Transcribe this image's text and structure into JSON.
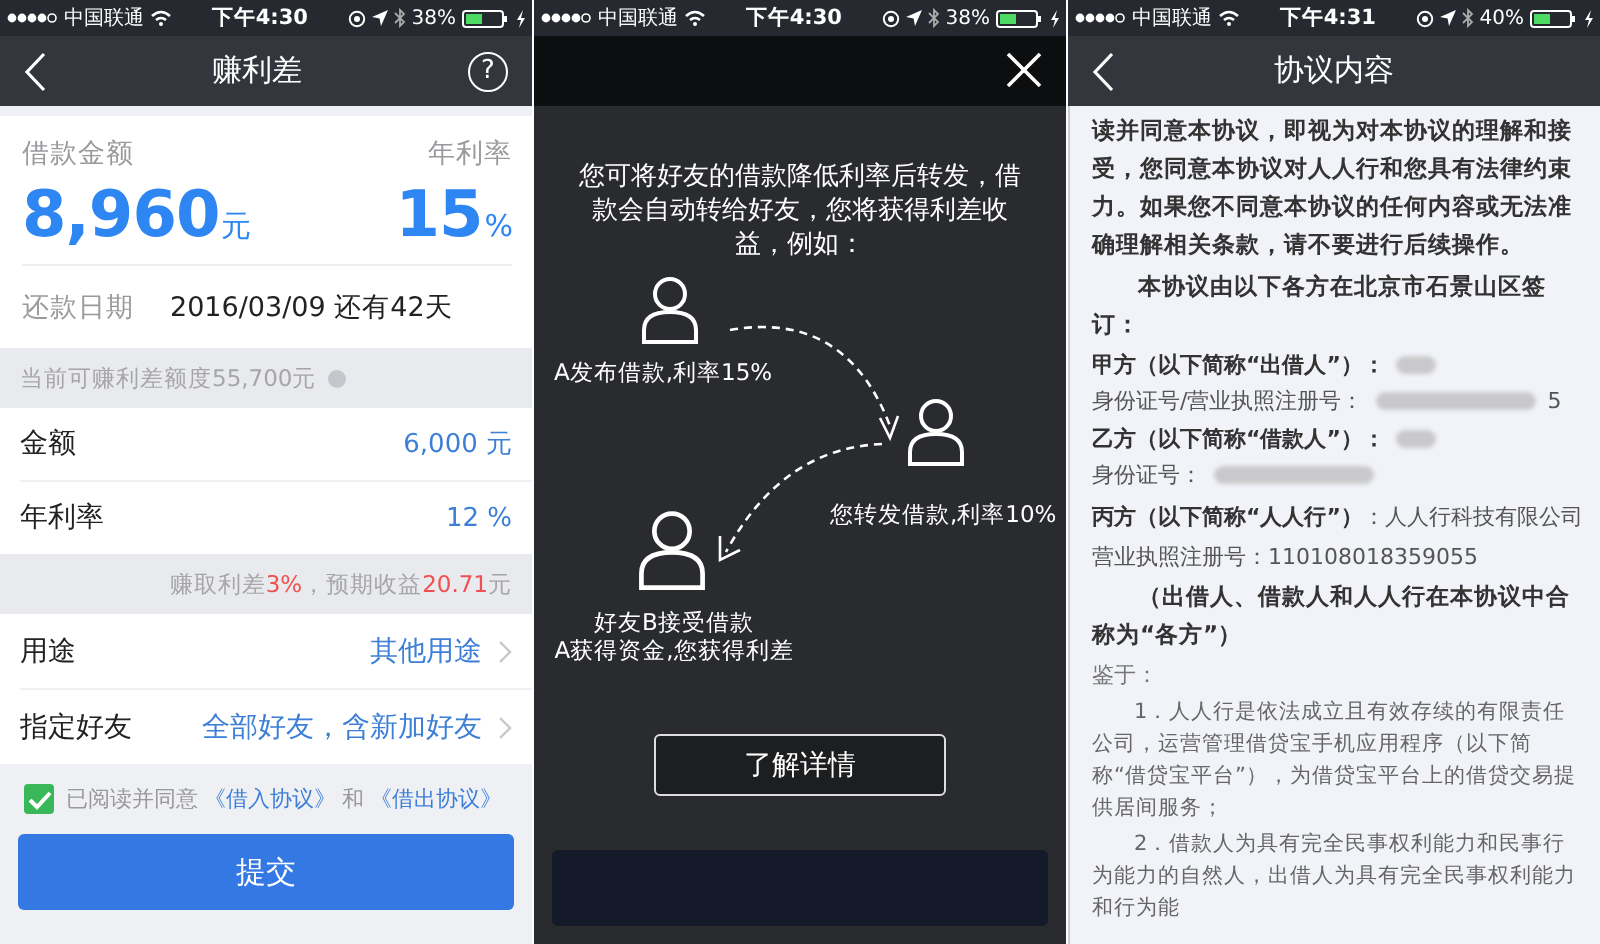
{
  "loan_screen": {
    "status_bar": {
      "carrier": "中国联通",
      "time": "下午4:30",
      "battery": "38%"
    },
    "nav": {
      "title": "赚利差",
      "help": "?"
    },
    "loan": {
      "amount_label": "借款金额",
      "amount": "8,960",
      "amount_unit": "元",
      "rate_label": "年利率",
      "rate": "15",
      "rate_unit": "%",
      "due_label": "还款日期",
      "due_value": "2016/03/09 还有42天",
      "quota_note": "当前可赚利差额度55,700元",
      "rate_rows": [
        {
          "label": "金额",
          "value": "6,000 元"
        },
        {
          "label": "年利率",
          "value": "12 %"
        }
      ],
      "profit_note": "赚取利差**3%**，预期收益**20.71**元",
      "option_rows": [
        {
          "label": "用途",
          "value": "其他用途"
        },
        {
          "label": "指定好友",
          "value": "全部好友，含新加好友"
        }
      ],
      "agreement": {
        "checked": true,
        "text": "已阅读并同意",
        "link_1": "《借入协议》",
        "joiner": "和",
        "link_2": "《借出协议》"
      },
      "submit": "提交"
    }
  },
  "guide_screen": {
    "status_bar": {
      "carrier": "中国联通",
      "time": "下午4:30",
      "battery": "38%"
    },
    "overlay": {
      "intro": "您可将好友的借款降低利率后转发，借款会自动转给好友，您将获得利差收益，例如：",
      "steps": [
        {
          "lines": [
            "A发布借款,利率15%"
          ]
        },
        {
          "lines": [
            "您转发借款,利率10%"
          ]
        },
        {
          "lines": [
            "好友B接受借款",
            "A获得资金,您获得利差"
          ]
        }
      ],
      "button": "了解详情"
    }
  },
  "agreement_screen": {
    "status_bar": {
      "carrier": "中国联通",
      "time": "下午4:31",
      "battery": "40%"
    },
    "nav": {
      "title": "协议内容"
    },
    "paragraphs": [
      {
        "kind": "notice",
        "text": "读并同意本协议，即视为对本协议的理解和接受，您同意本协议对人人行和您具有法律约束力。如果您不同意本协议的任何内容或无法准确理解相关条款，请不要进行后续操作。"
      },
      {
        "kind": "heading",
        "text": "本协议由以下各方在北京市石景山区签订："
      },
      {
        "kind": "party",
        "lines": [
          {
            "kind": "name_redacted",
            "label": "甲方（以下简称“出借人”）："
          },
          {
            "kind": "id_redacted",
            "label": "身份证号/营业执照注册号：",
            "suffix": "5"
          }
        ]
      },
      {
        "kind": "party",
        "lines": [
          {
            "kind": "name_redacted",
            "label": "乙方（以下简称“借款人”）："
          },
          {
            "kind": "id_redacted",
            "label": "身份证号："
          }
        ]
      },
      {
        "kind": "party",
        "lines": [
          {
            "kind": "plain",
            "label": "**丙方（以下简称“人人行”）**：人人行科技有限公司"
          },
          {
            "kind": "plain",
            "label": "营业执照注册号：110108018359055"
          }
        ]
      },
      {
        "kind": "heading",
        "text": "（出借人、借款人和人人行在本协议中合称为“各方”）"
      },
      {
        "kind": "muted",
        "text": "鉴于："
      },
      {
        "kind": "clause",
        "text": "1．人人行是依法成立且有效存续的有限责任公司，运营管理借贷宝手机应用程序（以下简称“借贷宝平台”），为借贷宝平台上的借贷交易提供居间服务；"
      },
      {
        "kind": "clause",
        "text": "2．借款人为具有完全民事权利能力和民事行为能力的自然人，出借人为具有完全民事权利能力和行为能"
      }
    ]
  }
}
